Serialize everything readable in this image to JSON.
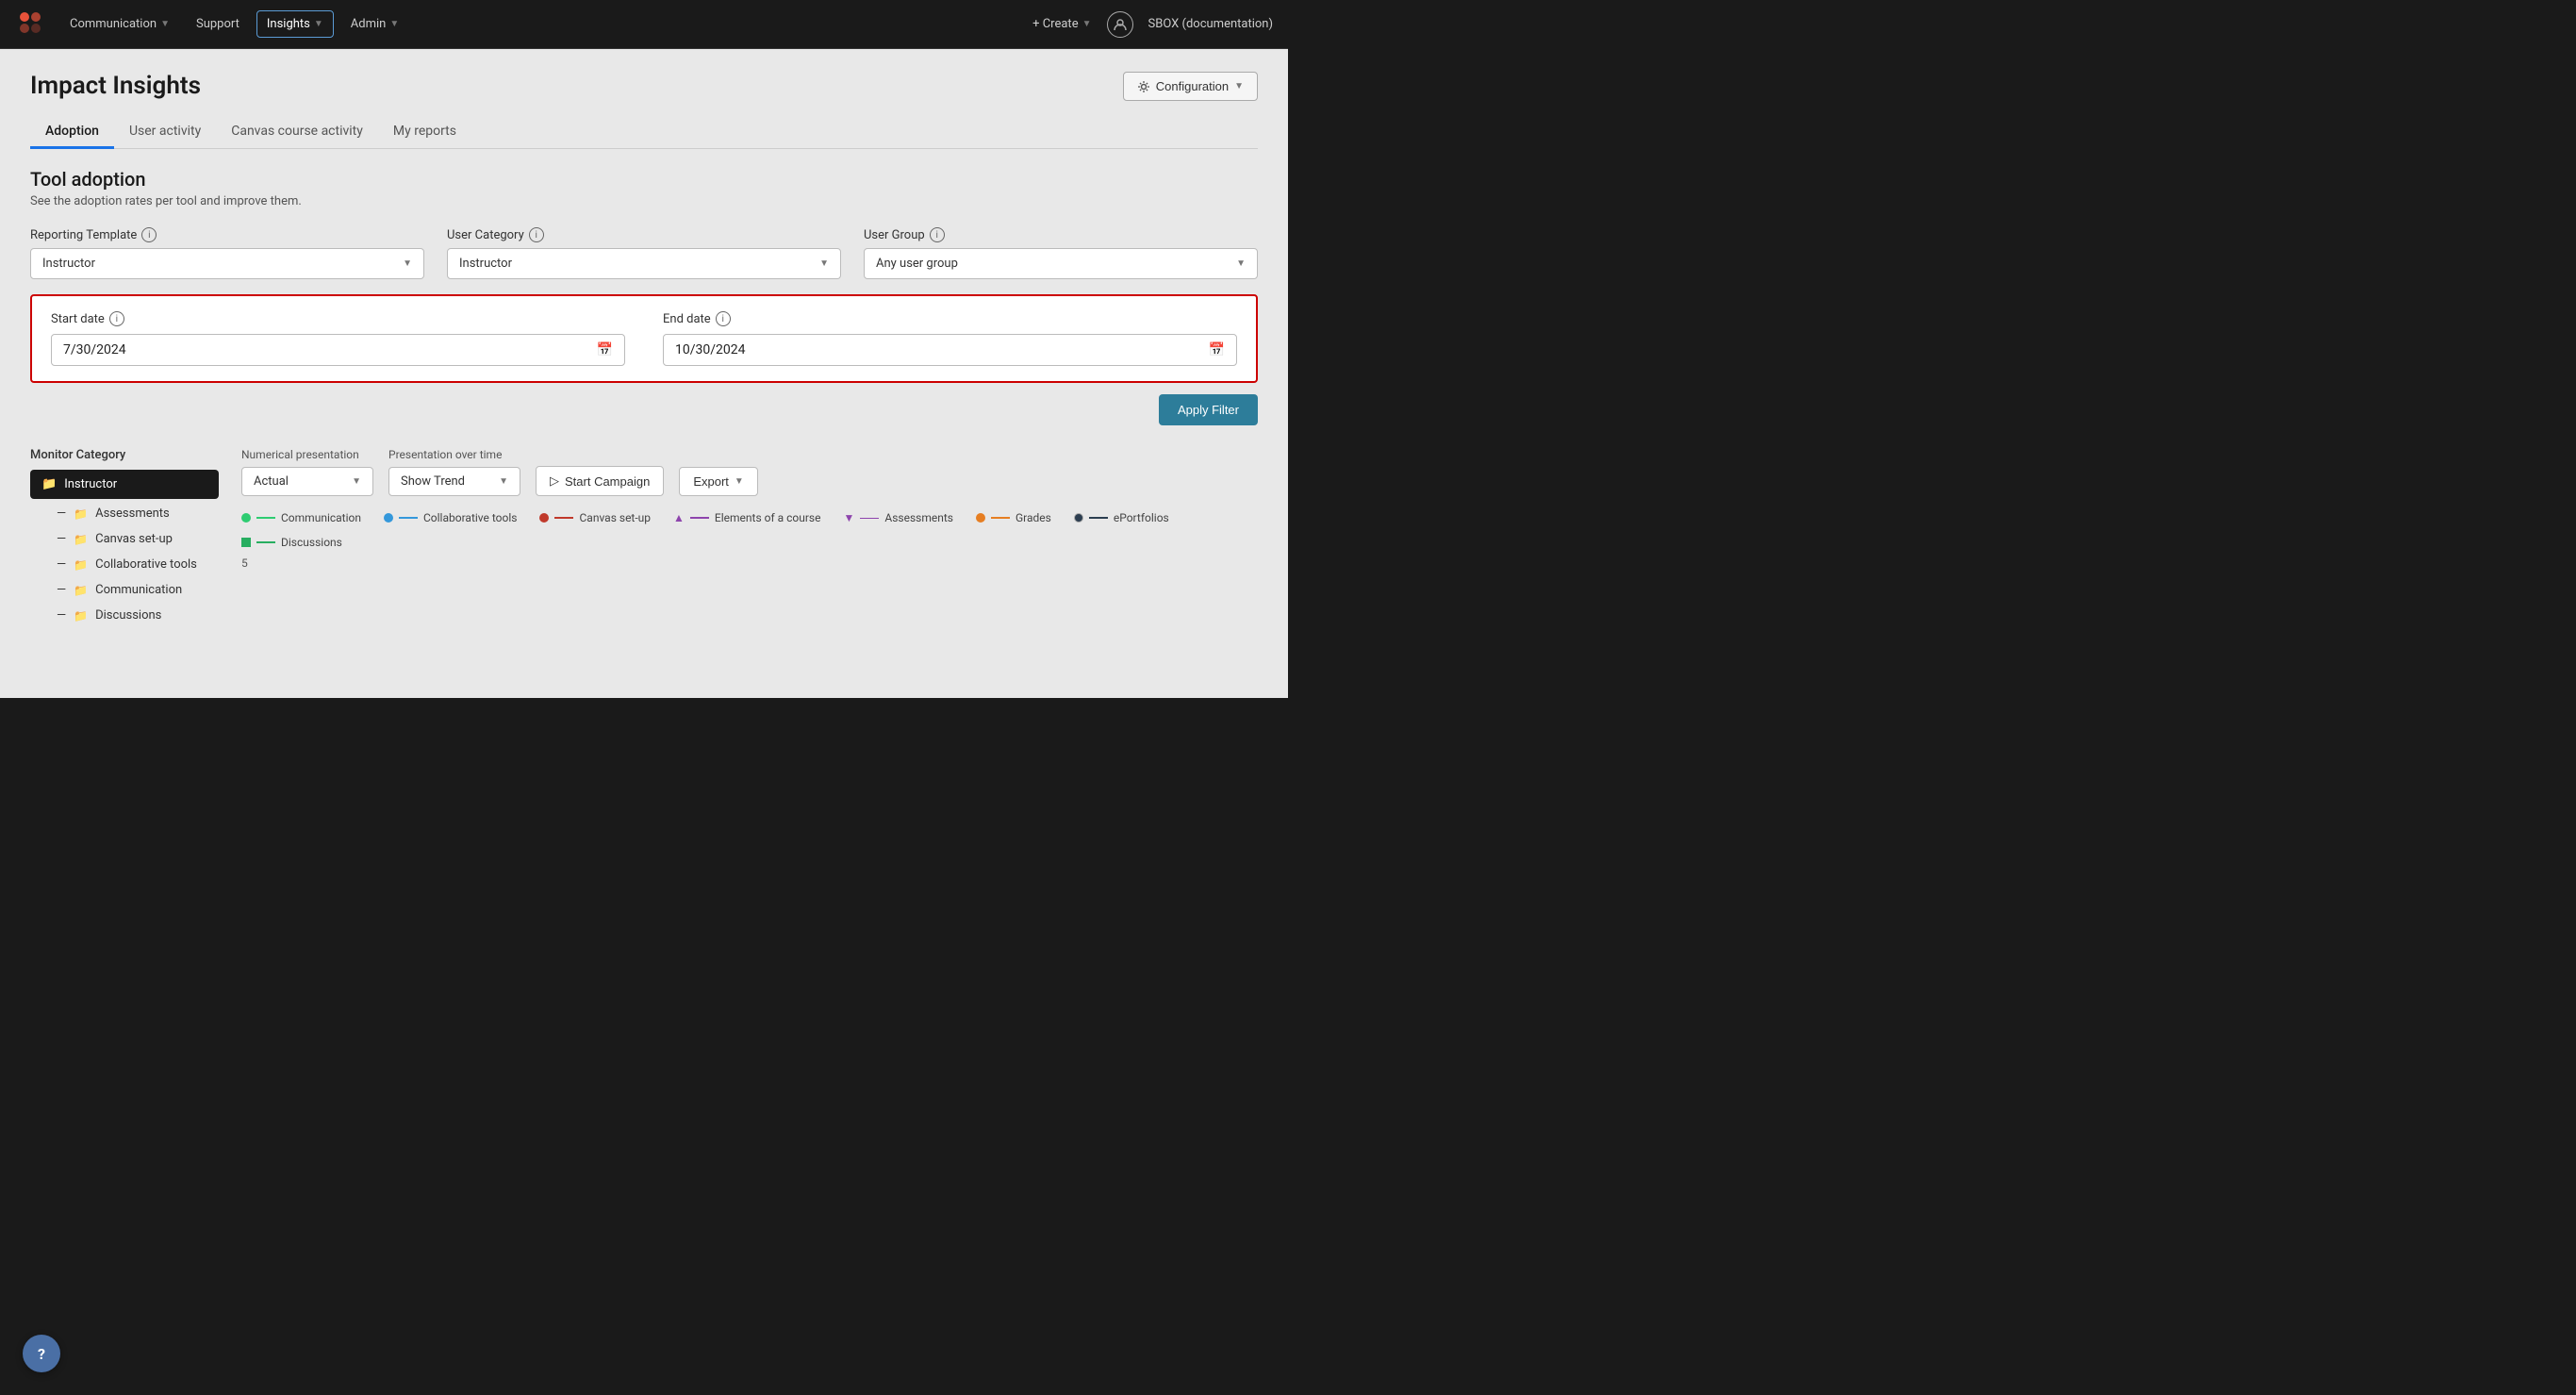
{
  "nav": {
    "logo_alt": "Instructure logo",
    "items": [
      {
        "label": "Communication",
        "active": false,
        "has_chevron": true
      },
      {
        "label": "Support",
        "active": false,
        "has_chevron": false
      },
      {
        "label": "Insights",
        "active": true,
        "has_chevron": true
      },
      {
        "label": "Admin",
        "active": false,
        "has_chevron": true
      }
    ],
    "create_label": "+ Create",
    "org_label": "SBOX (documentation)"
  },
  "page": {
    "title": "Impact Insights",
    "config_label": "Configuration"
  },
  "tabs": [
    {
      "label": "Adoption",
      "active": true
    },
    {
      "label": "User activity",
      "active": false
    },
    {
      "label": "Canvas course activity",
      "active": false
    },
    {
      "label": "My reports",
      "active": false
    }
  ],
  "section": {
    "title": "Tool adoption",
    "subtitle": "See the adoption rates per tool and improve them."
  },
  "filters": {
    "reporting_template": {
      "label": "Reporting Template",
      "value": "Instructor"
    },
    "user_category": {
      "label": "User Category",
      "value": "Instructor"
    },
    "user_group": {
      "label": "User Group",
      "value": "Any user group"
    },
    "start_date": {
      "label": "Start date",
      "value": "7/30/2024"
    },
    "end_date": {
      "label": "End date",
      "value": "10/30/2024"
    },
    "apply_label": "Apply Filter"
  },
  "monitor_category": {
    "title": "Monitor Category",
    "active_item": "Instructor",
    "sub_items": [
      "Assessments",
      "Canvas set-up",
      "Collaborative tools",
      "Communication",
      "Discussions"
    ]
  },
  "chart_controls": {
    "numerical_label": "Numerical presentation",
    "numerical_value": "Actual",
    "presentation_label": "Presentation over time",
    "presentation_value": "Show Trend",
    "start_campaign_label": "Start Campaign",
    "export_label": "Export"
  },
  "legend": [
    {
      "label": "Communication",
      "color": "#2ecc71",
      "style": "line"
    },
    {
      "label": "Collaborative tools",
      "color": "#3498db",
      "style": "line"
    },
    {
      "label": "Canvas set-up",
      "color": "#c0392b",
      "style": "line"
    },
    {
      "label": "Elements of a course",
      "color": "#8e44ad",
      "style": "triangle"
    },
    {
      "label": "Assessments",
      "color": "#8e44ad",
      "style": "arrow-down"
    },
    {
      "label": "Grades",
      "color": "#e67e22",
      "style": "circle"
    },
    {
      "label": "ePortfolios",
      "color": "#2c3e50",
      "style": "circle"
    },
    {
      "label": "Discussions",
      "color": "#27ae60",
      "style": "square"
    }
  ],
  "chart": {
    "y_start": "5"
  },
  "help": {
    "label": "?"
  }
}
